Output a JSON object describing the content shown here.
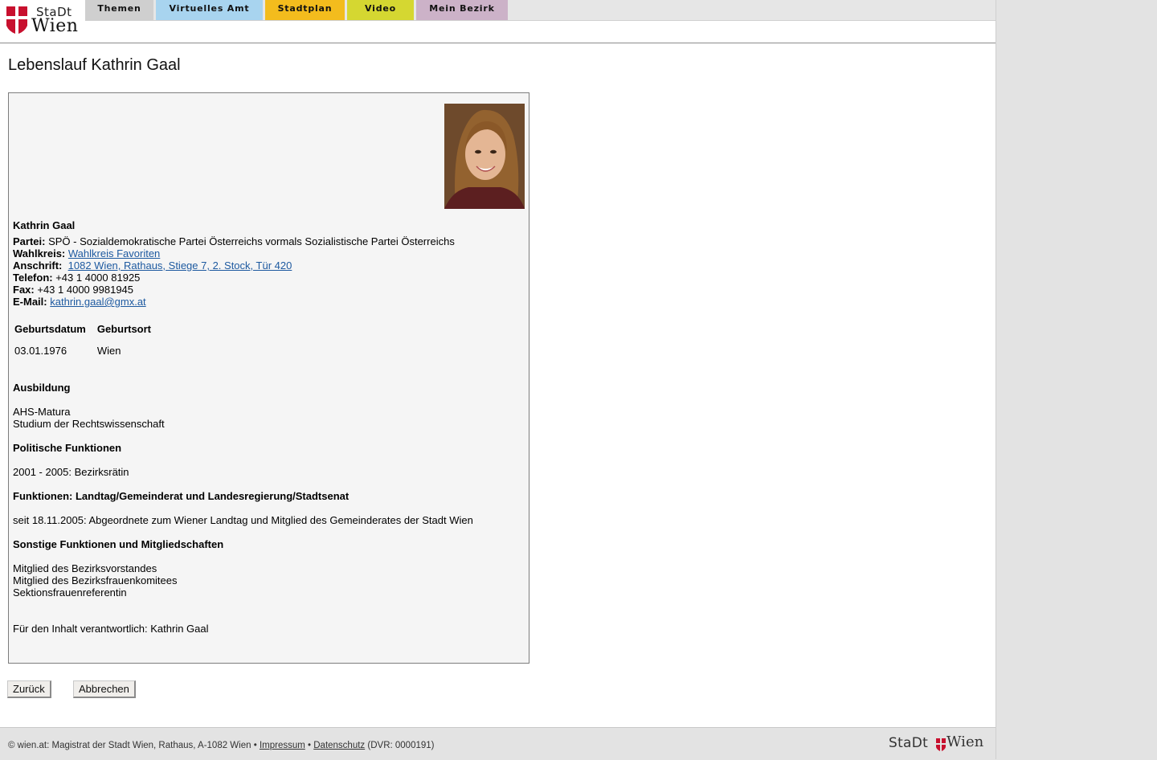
{
  "brand": {
    "stadt": "StaDt",
    "wien": "Wien"
  },
  "nav": {
    "tabs": [
      {
        "label": "Themen",
        "color": "#cfcfcf"
      },
      {
        "label": "Virtuelles Amt",
        "color": "#a8d4ef"
      },
      {
        "label": "Stadtplan",
        "color": "#f3bc1d"
      },
      {
        "label": "Video",
        "color": "#d5d731"
      },
      {
        "label": "Mein Bezirk",
        "color": "#ccb2c8"
      }
    ]
  },
  "page_title": "Lebenslauf Kathrin Gaal",
  "profile": {
    "name": "Kathrin Gaal",
    "partei_label": "Partei:",
    "partei": "SPÖ - Sozialdemokratische Partei Österreichs vormals Sozialistische Partei Österreichs",
    "wahlkreis_label": "Wahlkreis:",
    "wahlkreis": "Wahlkreis Favoriten",
    "anschrift_label": "Anschrift:",
    "anschrift": "1082 Wien, Rathaus, Stiege 7, 2. Stock, Tür 420",
    "telefon_label": "Telefon:",
    "telefon": "+43 1 4000 81925",
    "fax_label": "Fax:",
    "fax": "+43 1 4000 9981945",
    "email_label": "E-Mail:",
    "email": "kathrin.gaal@gmx.at",
    "birth": {
      "headers": [
        "Geburtsdatum",
        "Geburtsort"
      ],
      "values": [
        "03.01.1976",
        "Wien"
      ]
    },
    "sections": [
      {
        "title": "Ausbildung",
        "lines": [
          "AHS-Matura",
          "Studium der Rechtswissenschaft"
        ]
      },
      {
        "title": "Politische Funktionen",
        "lines": [
          "2001 - 2005: Bezirksrätin"
        ]
      },
      {
        "title": "Funktionen: Landtag/Gemeinderat und Landesregierung/Stadtsenat",
        "lines": [
          "seit 18.11.2005: Abgeordnete zum Wiener Landtag und Mitglied des Gemeinderates der Stadt Wien"
        ]
      },
      {
        "title": "Sonstige Funktionen und Mitgliedschaften",
        "lines": [
          "Mitglied des Bezirksvorstandes",
          "Mitglied des Bezirksfrauenkomitees",
          "Sektionsfrauenreferentin"
        ]
      }
    ],
    "responsible": "Für den Inhalt verantwortlich: Kathrin Gaal"
  },
  "buttons": {
    "back": "Zurück",
    "cancel": "Abbrechen"
  },
  "footer": {
    "copyright": "© wien.at: Magistrat der Stadt Wien, Rathaus, A-1082 Wien •",
    "impressum": "Impressum",
    "sep": "•",
    "datenschutz": "Datenschutz",
    "dvr": "(DVR: 0000191)",
    "logo_stadt": "StaDt",
    "logo_wien": "Wien"
  }
}
